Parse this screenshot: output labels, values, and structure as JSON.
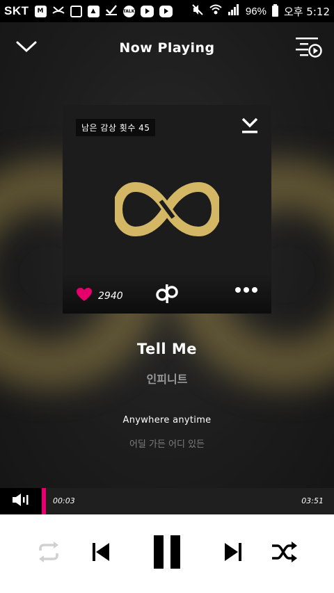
{
  "status_bar": {
    "carrier": "SKT",
    "talk_label": "TALK",
    "battery_pct": "96%",
    "time": "오후 5:12"
  },
  "header": {
    "title": "Now Playing"
  },
  "album": {
    "remaining_label": "남은 감상 횟수 45",
    "like_count": "2940"
  },
  "track": {
    "title": "Tell Me",
    "artist": "인피니트"
  },
  "lyrics": {
    "current": "Anywhere anytime",
    "next": "어딜 가든 어디 있든"
  },
  "progress": {
    "current_time": "00:03",
    "total_time": "03:51",
    "fraction": 0.013
  },
  "colors": {
    "accent": "#e5006e",
    "logo_gold": "#d4b765",
    "background": "#1b1b1b",
    "controls_bg": "#ffffff"
  }
}
